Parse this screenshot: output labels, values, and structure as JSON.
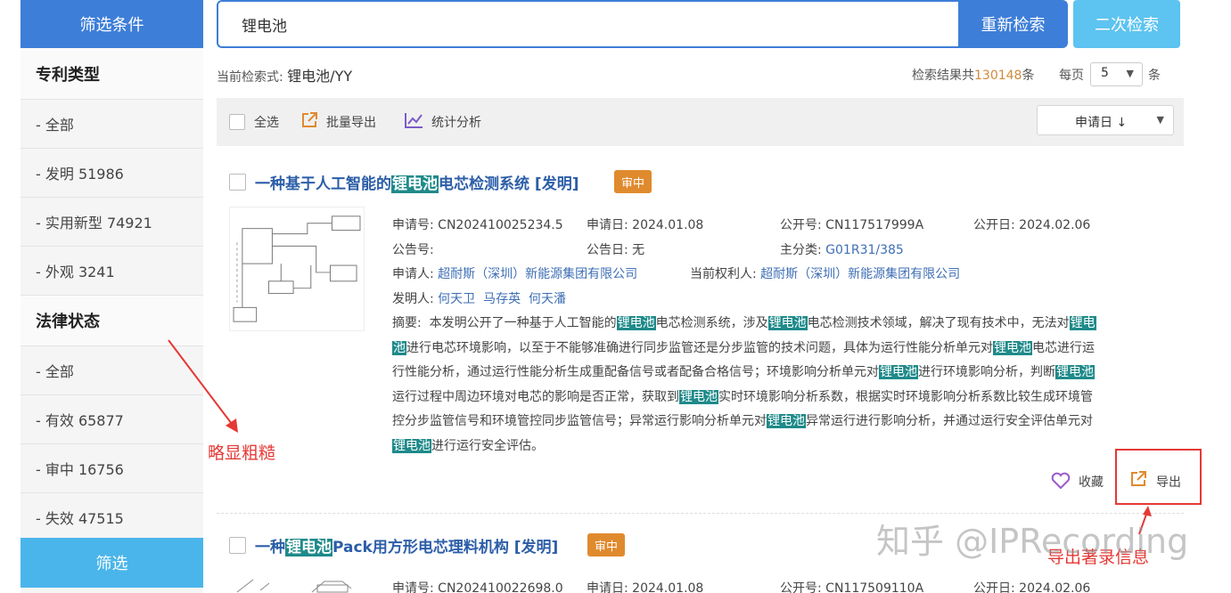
{
  "sidebar": {
    "title": "筛选条件",
    "patent_type": {
      "heading": "专利类型",
      "items": [
        "- 全部",
        "- 发明 51986",
        "- 实用新型 74921",
        "- 外观 3241"
      ]
    },
    "legal_status": {
      "heading": "法律状态",
      "items": [
        "- 全部",
        "- 有效 65877",
        "- 审中 16756",
        "- 失效 47515"
      ]
    },
    "filter_button": "筛选"
  },
  "search": {
    "query": "锂电池",
    "research_button": "重新检索",
    "secondary_button": "二次检索"
  },
  "query_info": {
    "label": "当前检索式:",
    "expression": "锂电池/YY",
    "count_prefix": "检索结果共",
    "count": "130148",
    "count_suffix": "条",
    "per_page_label": "每页",
    "per_page_value": "5",
    "per_page_unit": "条"
  },
  "toolbar": {
    "select_all": "全选",
    "batch_export": "批量导出",
    "statistics": "统计分析",
    "sort": "申请日 ↓"
  },
  "results": [
    {
      "title_pre": "一种基于人工智能的",
      "title_hl": "锂电池",
      "title_post": "电芯检测系统 [发明]",
      "badge": "审中",
      "app_no_label": "申请号:",
      "app_no": "CN202410025234.5",
      "app_date_label": "申请日:",
      "app_date": "2024.01.08",
      "pub_no_label": "公开号:",
      "pub_no": "CN117517999A",
      "pub_date_label": "公开日:",
      "pub_date": "2024.02.06",
      "ann_no_label": "公告号:",
      "ann_date_label": "公告日:",
      "ann_date": "无",
      "main_class_label": "主分类:",
      "main_class": "G01R31/385",
      "applicant_label": "申请人:",
      "applicant": "超耐斯（深圳）新能源集团有限公司",
      "owner_label": "当前权利人:",
      "owner": "超耐斯（深圳）新能源集团有限公司",
      "inventor_label": "发明人:",
      "inventors": "何天卫  马存英  何天潘",
      "abstract_label": "摘要:",
      "abstract_lines": [
        [
          "本发明公开了一种基于人工智能的",
          "锂电池",
          "电芯检测系统，涉及",
          "锂电池",
          "电芯检测技术领域，解决了现有技术中，无法对",
          "锂电"
        ],
        [
          "池",
          "进行电芯环境影响，以至于不能够准确进行同步监管还是分步监管的技术问题，具体为运行性能分析单元对",
          "锂电池",
          "电芯进行运"
        ],
        [
          "行性能分析，通过运行性能分析生成重配备信号或者配备合格信号；环境影响分析单元对",
          "锂电池",
          "进行环境影响分析，判断",
          "锂电池"
        ],
        [
          "运行过程中周边环境对电芯的影响是否正常，获取到",
          "锂电池",
          "实时环境影响分析系数，根据实时环境影响分析系数比较生成环境管"
        ],
        [
          "控分步监管信号和环境管控同步监管信号；异常运行影响分析单元对",
          "锂电池",
          "异常运行进行影响分析，并通过运行安全评估单元对"
        ],
        [
          "锂电池",
          "进行运行安全评估。"
        ]
      ],
      "favorite": "收藏",
      "export": "导出"
    },
    {
      "title_pre": "一种",
      "title_hl": "锂电池",
      "title_post": "Pack用方形电芯理料机构 [发明]",
      "badge": "审中",
      "app_no_label": "申请号:",
      "app_no": "CN202410022698.0",
      "app_date_label": "申请日:",
      "app_date": "2024.01.08",
      "pub_no_label": "公开号:",
      "pub_no": "CN117509110A",
      "pub_date_label": "公开日:",
      "pub_date": "2024.02.06"
    }
  ],
  "annotations": {
    "rough": "略显粗糙",
    "export_info": "导出著录信息"
  },
  "watermark": "知乎 @IPRecording",
  "colors": {
    "primary": "#3d7ed8",
    "light_blue": "#4ab5ea",
    "highlight": "#1f8a8a",
    "badge": "#e08a2e",
    "annotation": "#e53935"
  }
}
